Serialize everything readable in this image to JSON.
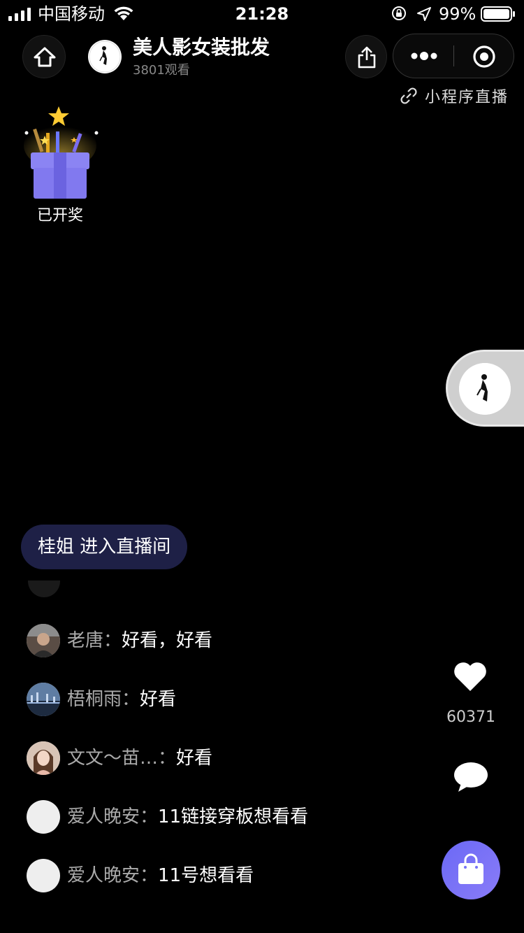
{
  "status_bar": {
    "carrier": "中国移动",
    "time": "21:28",
    "battery": "99%"
  },
  "header": {
    "title": "美人影女装批发",
    "viewers": "3801观看",
    "mini_program_tag": "小程序直播"
  },
  "lottery": {
    "label": "已开奖"
  },
  "join_notice": {
    "user": "桂姐",
    "text": "进入直播间"
  },
  "comments": [
    {
      "user": "老唐",
      "message": "好看，好看",
      "avatar": "photo-man"
    },
    {
      "user": "梧桐雨",
      "message": "好看",
      "avatar": "photo-night-city"
    },
    {
      "user": "文文～苗…",
      "message": "好看",
      "avatar": "photo-woman"
    },
    {
      "user": "爱人晚安",
      "message": "11链接穿板想看看",
      "avatar": "blank"
    },
    {
      "user": "爱人晚安",
      "message": "11号想看看",
      "avatar": "blank"
    }
  ],
  "actions": {
    "likes": "60371"
  },
  "icons": {
    "home": "home-icon",
    "share": "share-icon",
    "more": "more-dots-icon",
    "close": "target-icon",
    "link": "link-icon",
    "heart": "heart-icon",
    "comment": "chat-bubble-icon",
    "shop": "shopping-bag-icon"
  },
  "colors": {
    "background": "#000000",
    "join_notice_bg": "#1e2046",
    "shop_button": "#7572f6",
    "username": "#aaaaaa"
  }
}
